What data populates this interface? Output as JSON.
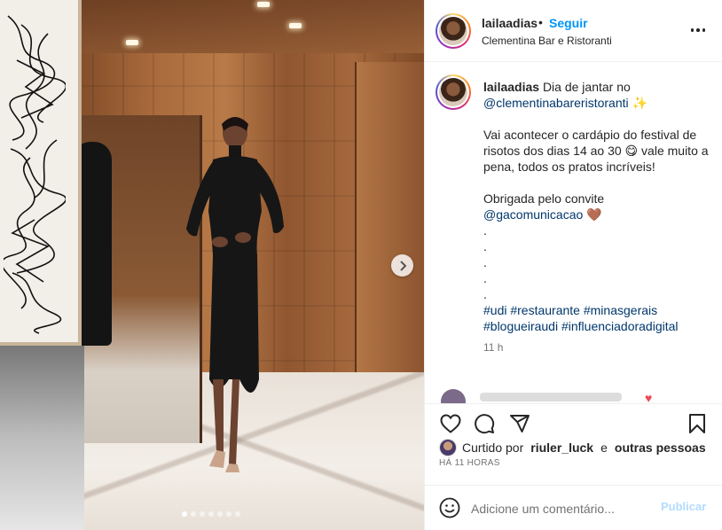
{
  "header": {
    "username": "lailaadias",
    "separator": "•",
    "follow_label": "Seguir",
    "location": "Clementina Bar e Ristoranti",
    "more_icon": "more-horizontal-icon"
  },
  "post": {
    "image_description_icon": "photo",
    "carousel_total": 7,
    "carousel_active_index": 0
  },
  "caption": {
    "username": "lailaadias",
    "line1_text": "Dia de jantar no",
    "mention1": "@clementinabareristoranti",
    "emoji1": "✨",
    "para2_a": "Vai acontecer o cardápio do festival de risotos dos dias 14 ao 30",
    "emoji2": "😋",
    "para2_b": "vale muito a pena, todos os pratos incríveis!",
    "para3": "Obrigada pelo convite",
    "mention2": "@gacomunicacao",
    "emoji3": "🤎",
    "dots": [
      ".",
      ".",
      ".",
      ".",
      "."
    ],
    "hashtags_line1": [
      "#udi",
      "#restaurante",
      "#minasgerais"
    ],
    "hashtags_line2": [
      "#blogueiraudi",
      "#influenciadoradigital"
    ],
    "time": "11 h"
  },
  "actions": {
    "like_icon": "heart-icon",
    "comment_icon": "comment-icon",
    "share_icon": "share-icon",
    "save_icon": "bookmark-icon"
  },
  "likes": {
    "prefix": "Curtido por",
    "user": "riuler_luck",
    "conj": "e",
    "others": "outras pessoas"
  },
  "posted_ago": "HÁ 11 HORAS",
  "comment_box": {
    "placeholder": "Adicione um comentário...",
    "post_label": "Publicar"
  },
  "colors": {
    "link": "#0095f6",
    "mention": "#00376b",
    "muted": "#737373",
    "publish_disabled": "#b3dbff"
  }
}
